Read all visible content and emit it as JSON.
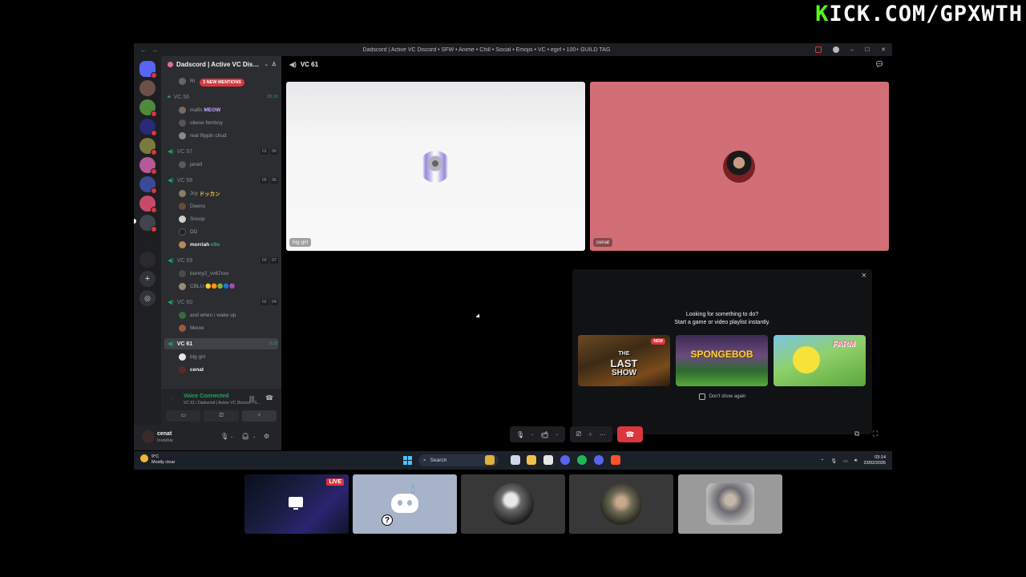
{
  "overlay": {
    "kick_prefix": "K",
    "kick_rest": "ICK.COM/GPXWTH"
  },
  "window": {
    "title": "Dadscord | Active VC Discord • SFW • Anime • Chill • Social • Emojis • VC • egirl • 100+ GUILD TAG",
    "minimize": "–",
    "maximize": "☐",
    "close": "✕"
  },
  "server": {
    "name": "Dadscord | Active VC Disc...",
    "mentions_pill": "3 NEW MENTIONS",
    "channels": [
      {
        "name": "VC 56",
        "timer": "20:16"
      },
      {
        "name": "VC 57",
        "count_a": "01",
        "count_b": "06"
      },
      {
        "name": "VC 58",
        "count_a": "05",
        "count_b": "06"
      },
      {
        "name": "VC 59",
        "count_a": "02",
        "count_b": "07"
      },
      {
        "name": "VC 60",
        "count_a": "02",
        "count_b": "04"
      },
      {
        "name": "VC 61",
        "timer": "0:21"
      }
    ],
    "members": {
      "vc56": [
        "mafis",
        "obese femboy",
        "real flippin chud"
      ],
      "vc56_tag": "MEOW",
      "vc57": [
        "jenell"
      ],
      "vc58": [
        "Jcy",
        "Deeno",
        "Snoop",
        "DD",
        "morriah"
      ],
      "vc58_tags": {
        "jcy": "ドッカン",
        "morriah": "e9o"
      },
      "vc59": [
        "bunny2_vv67xxx",
        "CBLU"
      ],
      "vc60": [
        "and when i wake up",
        "Meow"
      ],
      "vc61": [
        "big girl",
        "cenat"
      ]
    }
  },
  "voice_panel": {
    "status": "Voice Connected",
    "subtitle": "VC 61 / Dadscord | Active VC Discord • S..."
  },
  "user_panel": {
    "name": "cenat",
    "status": "Invisible"
  },
  "call": {
    "channel_title": "VC 61",
    "tiles": [
      {
        "name": "big girl"
      },
      {
        "name": "cenat"
      }
    ],
    "activity": {
      "headline_1": "Looking for something to do?",
      "headline_2": "Start a game or video playlist instantly.",
      "games": [
        {
          "title_1": "THE",
          "title_2": "LAST",
          "title_3": "SHOW",
          "new_badge": "NEW"
        },
        {
          "title": "SPONGEBOB"
        },
        {
          "title": "FARM"
        }
      ],
      "dont_show": "Don't show again"
    }
  },
  "taskbar": {
    "weather_temp": "9°C",
    "weather_desc": "Mostly clear",
    "search_placeholder": "Search",
    "time": "03:14",
    "date": "23/02/2026"
  },
  "stream_strip": {
    "live_label": "LIVE"
  },
  "colors": {
    "discord_green": "#23a55a",
    "danger_red": "#da373c",
    "kick_green": "#53fc18"
  }
}
